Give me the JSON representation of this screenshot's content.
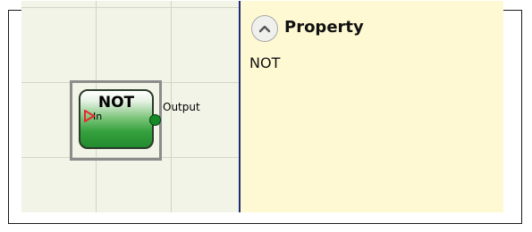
{
  "canvas": {
    "block": {
      "title": "NOT",
      "input_label": "In",
      "output_label": "Output"
    }
  },
  "property_panel": {
    "title": "Property",
    "value": "NOT",
    "icons": {
      "collapse": "chevron-up-icon"
    }
  },
  "colors": {
    "block_green": "#36a13e",
    "panel_bg": "#fef9d2",
    "divider": "#1f2a7a",
    "input_marker": "#e8282f"
  }
}
